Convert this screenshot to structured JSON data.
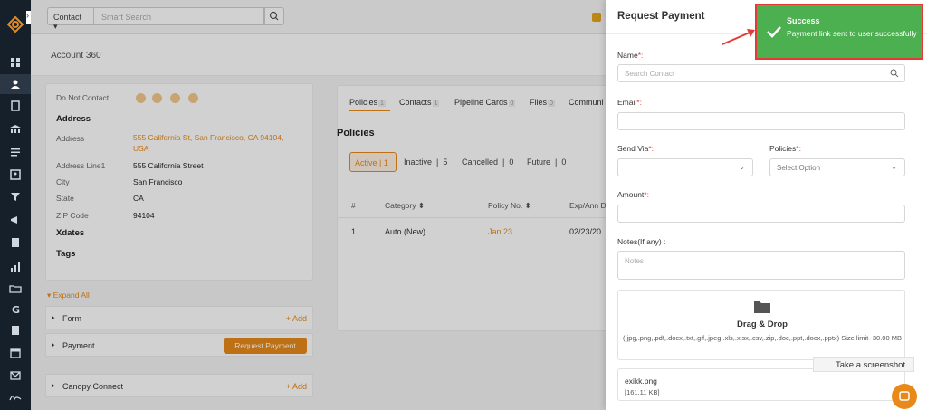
{
  "topbar": {
    "contact_select": "Contact",
    "search_placeholder": "Smart Search"
  },
  "page": {
    "title": "Account 360"
  },
  "details": {
    "do_not_contact": "Do Not Contact",
    "address_heading": "Address",
    "fields": [
      {
        "label": "Address",
        "value": "555 California St, San Francisco, CA 94104, USA"
      },
      {
        "label": "Address Line1",
        "value": "555 California Street"
      },
      {
        "label": "City",
        "value": "San Francisco"
      },
      {
        "label": "State",
        "value": "CA"
      },
      {
        "label": "ZIP Code",
        "value": "94104"
      }
    ],
    "xdates_heading": "Xdates",
    "tags_heading": "Tags"
  },
  "accordion": {
    "expand_all": "Expand All",
    "rows": [
      {
        "label": "Form",
        "action": "+ Add"
      },
      {
        "label": "Payment",
        "action": "Request Payment"
      },
      {
        "label": "Canopy Connect",
        "action": "+ Add"
      }
    ]
  },
  "tabs": [
    {
      "label": "Policies",
      "count": "1"
    },
    {
      "label": "Contacts",
      "count": "1"
    },
    {
      "label": "Pipeline Cards",
      "count": "0"
    },
    {
      "label": "Files",
      "count": "0"
    },
    {
      "label": "Communi",
      "count": ""
    }
  ],
  "policies": {
    "heading": "Policies",
    "statuses": [
      {
        "label": "Active",
        "count": "1"
      },
      {
        "label": "Inactive",
        "count": "5"
      },
      {
        "label": "Cancelled",
        "count": "0"
      },
      {
        "label": "Future",
        "count": "0"
      }
    ],
    "columns": [
      "#",
      "Category",
      "Policy No.",
      "Exp/Ann D"
    ],
    "rows": [
      {
        "num": "1",
        "category": "Auto (New)",
        "policy_no": "Jan 23",
        "date": "02/23/20"
      }
    ]
  },
  "drawer": {
    "title": "Request Payment",
    "name_label": "Name",
    "name_placeholder": "Search Contact",
    "email_label": "Email",
    "send_via_label": "Send Via",
    "policies_label": "Policies",
    "policies_placeholder": "Select Option",
    "amount_label": "Amount",
    "notes_label": "Notes(If any) :",
    "notes_placeholder": "Notes",
    "required_mark": "*:",
    "dropzone_title": "Drag & Drop",
    "dropzone_types": "(.jpg,.png,.pdf,.docx,.txt,.gif,.jpeg,.xls,.xlsx,.csv,.zip,.doc,.ppt,.docx,.pptx) Size limit- 30.00 MB",
    "file_name": "exikk.png",
    "file_size": "[161.11 KB]"
  },
  "toast": {
    "title": "Success",
    "message": "Payment link sent to user successfully"
  },
  "tooltip": "Take a screenshot",
  "colors": {
    "accent": "#e8891a",
    "success": "#4caf50",
    "highlight": "#e53935",
    "sidebar": "#15202b"
  }
}
